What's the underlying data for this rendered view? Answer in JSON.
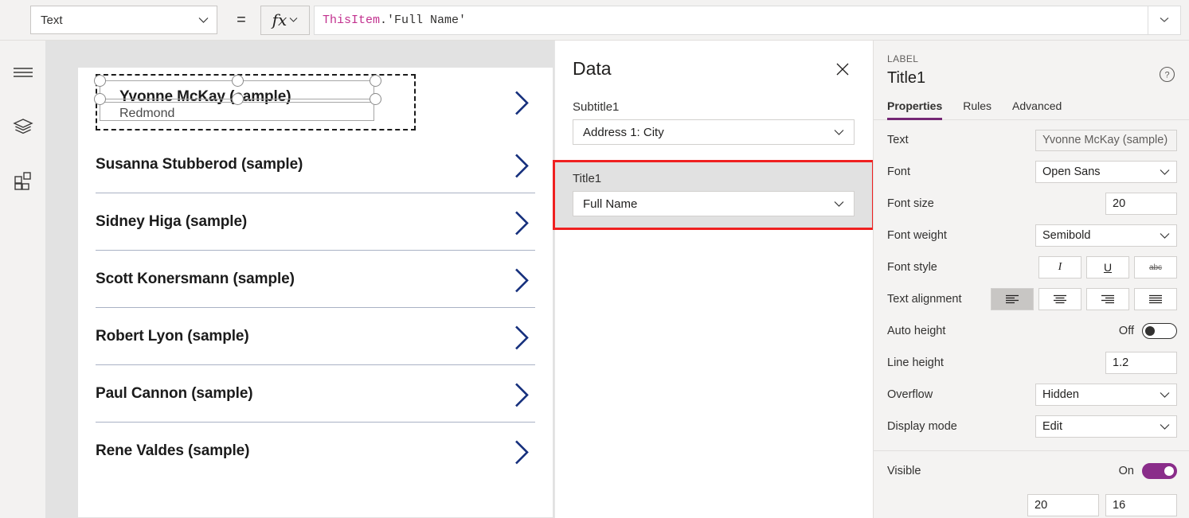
{
  "formula_bar": {
    "property_selector": {
      "value": "Text",
      "icon": "chevron-down-icon"
    },
    "equals": "=",
    "fx_label": "fx",
    "formula": {
      "identifier": "ThisItem",
      "rest": ".'Full Name'"
    },
    "collapse_icon": "chevron-down-icon"
  },
  "left_rail": {
    "items": [
      {
        "name": "hamburger-menu-icon"
      },
      {
        "name": "tree-view-icon"
      },
      {
        "name": "insert-components-icon"
      }
    ]
  },
  "gallery": {
    "items": [
      {
        "title": "Yvonne McKay (sample)",
        "subtitle": "Redmond",
        "selected": true
      },
      {
        "title": "Susanna Stubberod (sample)",
        "subtitle": "",
        "selected": false
      },
      {
        "title": "Sidney Higa (sample)",
        "subtitle": "",
        "selected": false
      },
      {
        "title": "Scott Konersmann (sample)",
        "subtitle": "",
        "selected": false
      },
      {
        "title": "Robert Lyon (sample)",
        "subtitle": "",
        "selected": false
      },
      {
        "title": "Paul Cannon (sample)",
        "subtitle": "",
        "selected": false
      },
      {
        "title": "Rene Valdes (sample)",
        "subtitle": "",
        "selected": false
      }
    ],
    "chevron_color": "#16307d"
  },
  "data_panel": {
    "title": "Data",
    "close_icon": "close-icon",
    "fields": [
      {
        "label": "Subtitle1",
        "value": "Address 1: City",
        "highlighted": false
      },
      {
        "label": "Title1",
        "value": "Full Name",
        "highlighted": true
      }
    ],
    "highlight_color": "#ef2020"
  },
  "properties_panel": {
    "kind": "LABEL",
    "control_name": "Title1",
    "help_icon": "help-circle-icon",
    "tabs": [
      {
        "label": "Properties",
        "active": true
      },
      {
        "label": "Rules",
        "active": false
      },
      {
        "label": "Advanced",
        "active": false
      }
    ],
    "accent_color": "#742774",
    "rows": [
      {
        "label": "Text",
        "type": "readonly",
        "value": "Yvonne McKay (sample)"
      },
      {
        "label": "Font",
        "type": "dropdown",
        "value": "Open Sans"
      },
      {
        "label": "Font size",
        "type": "number",
        "value": "20"
      },
      {
        "label": "Font weight",
        "type": "dropdown",
        "value": "Semibold"
      },
      {
        "label": "Font style",
        "type": "style-buttons",
        "buttons": [
          {
            "glyph": "I",
            "name": "italic-button",
            "selected": false
          },
          {
            "glyph": "U",
            "name": "underline-button",
            "selected": false
          },
          {
            "glyph": "abc",
            "name": "strikethrough-button",
            "selected": false
          }
        ]
      },
      {
        "label": "Text alignment",
        "type": "align-buttons",
        "buttons": [
          {
            "name": "align-left-button",
            "selected": true
          },
          {
            "name": "align-center-button",
            "selected": false
          },
          {
            "name": "align-right-button",
            "selected": false
          },
          {
            "name": "align-justify-button",
            "selected": false
          }
        ]
      },
      {
        "label": "Auto height",
        "type": "toggle",
        "state": "Off",
        "on": false
      },
      {
        "label": "Line height",
        "type": "number",
        "value": "1.2"
      },
      {
        "label": "Overflow",
        "type": "dropdown",
        "value": "Hidden"
      },
      {
        "label": "Display mode",
        "type": "dropdown",
        "value": "Edit"
      }
    ],
    "visible_row": {
      "label": "Visible",
      "state": "On",
      "on": true
    },
    "bottom_numbers": [
      "20",
      "16"
    ]
  }
}
